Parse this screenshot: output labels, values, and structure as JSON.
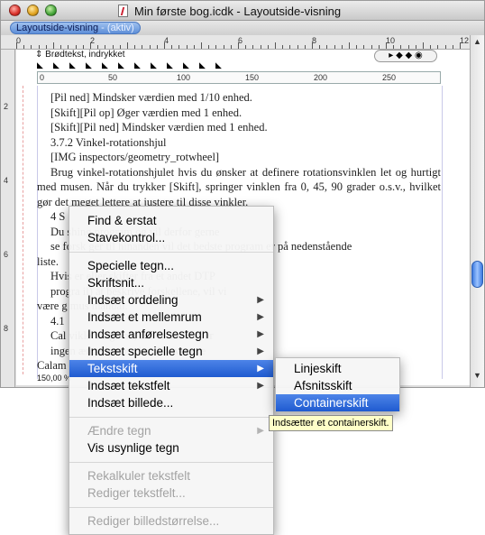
{
  "window": {
    "title": "Min første bog.icdk - Layoutside-visning",
    "tab_label": "Layoutside-visning",
    "tab_state": " - (aktiv)"
  },
  "hruler": [
    "0",
    "2",
    "4",
    "6",
    "8",
    "10",
    "12"
  ],
  "vruler": [
    "2",
    "4",
    "6",
    "8"
  ],
  "mruler": [
    "0",
    "50",
    "100",
    "150",
    "200",
    "250"
  ],
  "paragraph_style": "Brødtekst, indrykket",
  "zoom": "150,00 %",
  "document": {
    "lines": [
      "[Pil ned] Mindsker værdien med 1/10 enhed.",
      "[Skift][Pil op] Øger værdien med 1 enhed.",
      "[Skift][Pil ned] Mindsker værdien med 1 enhed.",
      "3.7.2   Vinkel-rotationshjul",
      "[IMG inspectors/geometry_rotwheel]",
      "Brug vinkel-rotationshjulet hvis du ønsker at definere rotationsvinklen let og hurtigt med musen. Når du trykker [Skift], springer vinklen fra 0, 45, 90 grader o.s.v., hvilket gør det meget lettere at justere til disse vinkler.",
      "4   S",
      "Du                          shing program og vil derfor gerne",
      "se forsk                    ger til hinanden vil det bedste program er på nedenstående",
      "liste.",
      "Hvis                        er eller skifter fra et andet DTP",
      "progra                      il) at beskrive forskellene, vil vi",
      "være g                      mus manual.",
      "4.1",
      "Cal                         viklere lige nu, det er alt. Der er",
      "ingen                       ængelig som kan konvertere",
      "Calam"
    ]
  },
  "context_menu": {
    "items": [
      {
        "label": "Find & erstat",
        "enabled": true,
        "submenu": false
      },
      {
        "label": "Stavekontrol...",
        "enabled": true,
        "submenu": false
      },
      {
        "sep": true
      },
      {
        "label": "Specielle tegn...",
        "enabled": true,
        "submenu": false
      },
      {
        "label": "Skriftsnit...",
        "enabled": true,
        "submenu": false
      },
      {
        "label": "Indsæt orddeling",
        "enabled": true,
        "submenu": true
      },
      {
        "label": "Indsæt et mellemrum",
        "enabled": true,
        "submenu": true
      },
      {
        "label": "Indsæt anførelsestegn",
        "enabled": true,
        "submenu": true
      },
      {
        "label": "Indsæt specielle tegn",
        "enabled": true,
        "submenu": true
      },
      {
        "label": "Tekstskift",
        "enabled": true,
        "submenu": true,
        "highlighted": true
      },
      {
        "label": "Indsæt tekstfelt",
        "enabled": true,
        "submenu": true
      },
      {
        "label": "Indsæt billede...",
        "enabled": true,
        "submenu": false
      },
      {
        "sep": true
      },
      {
        "label": "Ændre tegn",
        "enabled": false,
        "submenu": true
      },
      {
        "label": "Vis usynlige tegn",
        "enabled": true,
        "submenu": false
      },
      {
        "sep": true
      },
      {
        "label": "Rekalkuler tekstfelt",
        "enabled": false,
        "submenu": false
      },
      {
        "label": "Rediger tekstfelt...",
        "enabled": false,
        "submenu": false
      },
      {
        "sep": true
      },
      {
        "label": "Rediger billedstørrelse...",
        "enabled": false,
        "submenu": false
      }
    ]
  },
  "submenu": {
    "items": [
      {
        "label": "Linjeskift"
      },
      {
        "label": "Afsnitsskift"
      },
      {
        "label": "Containerskift",
        "highlighted": true
      }
    ]
  },
  "tooltip": "Indsætter et containerskift.",
  "colors": {
    "highlight": "#2a63d6",
    "tooltip_bg": "#ffffc8"
  }
}
